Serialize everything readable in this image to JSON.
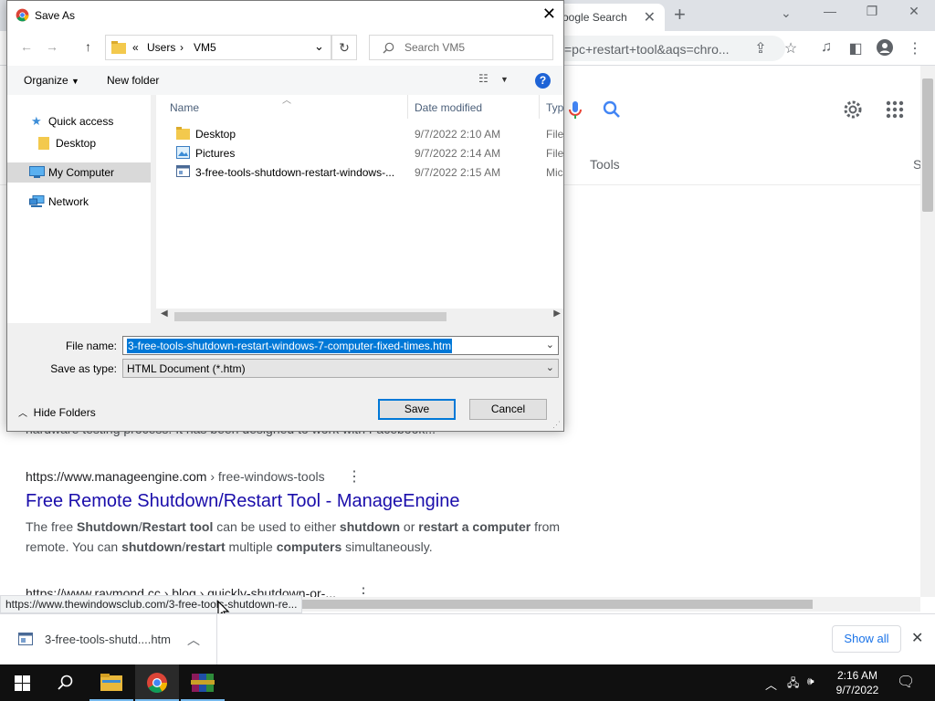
{
  "browser": {
    "tab_title": "oogle Search",
    "omnibox_text": "=pc+restart+tool&aqs=chro...",
    "search_tools": "Tools",
    "tools_overflow": "S",
    "result_top_snippet": "hardware testing process. It has been designed to work with Facebook...",
    "result1": {
      "url_domain": "https://www.manageengine.com",
      "url_crumb": " › free-windows-tools",
      "title": "Free Remote Shutdown/Restart Tool - ManageEngine",
      "desc_parts": [
        "The free ",
        "Shutdown",
        "/",
        "Restart tool",
        " can be used to either ",
        "shutdown",
        " or ",
        "restart a computer",
        " from remote. You can ",
        "shutdown",
        "/",
        "restart",
        " multiple ",
        "computers",
        " simultaneously."
      ]
    },
    "result2": {
      "url": "https://www.raymond.cc › blog › quickly-shutdown-or-..."
    },
    "status_url": "https://www.thewindowsclub.com/3-free-tools-shutdown-re...",
    "download": {
      "name": "3-free-tools-shutd....htm",
      "show_all": "Show all"
    }
  },
  "dialog": {
    "title": "Save As",
    "breadcrumb": [
      "«",
      "Users",
      "›",
      "VM5"
    ],
    "search_placeholder": "Search VM5",
    "organize": "Organize",
    "new_folder": "New folder",
    "nav_items": [
      {
        "label": "Quick access",
        "icon": "star-icon"
      },
      {
        "label": "Desktop",
        "icon": "folder-icon"
      },
      {
        "label": "My Computer",
        "icon": "computer-icon",
        "selected": true
      },
      {
        "label": "Network",
        "icon": "network-icon"
      }
    ],
    "columns": [
      "Name",
      "Date modified",
      "Type"
    ],
    "files": [
      {
        "name": "Desktop",
        "date": "9/7/2022 2:10 AM",
        "type": "File fo",
        "icon": "folder-icon"
      },
      {
        "name": "Pictures",
        "date": "9/7/2022 2:14 AM",
        "type": "File fo",
        "icon": "pictures-icon"
      },
      {
        "name": "3-free-tools-shutdown-restart-windows-...",
        "date": "9/7/2022 2:15 AM",
        "type": "Micro",
        "icon": "html-file-icon"
      }
    ],
    "file_name_label": "File name:",
    "file_name_value": "3-free-tools-shutdown-restart-windows-7-computer-fixed-times.htm",
    "save_type_label": "Save as type:",
    "save_type_value": "HTML Document (*.htm)",
    "hide_folders": "Hide Folders",
    "save": "Save",
    "cancel": "Cancel"
  },
  "taskbar": {
    "time": "2:16 AM",
    "date": "9/7/2022"
  }
}
